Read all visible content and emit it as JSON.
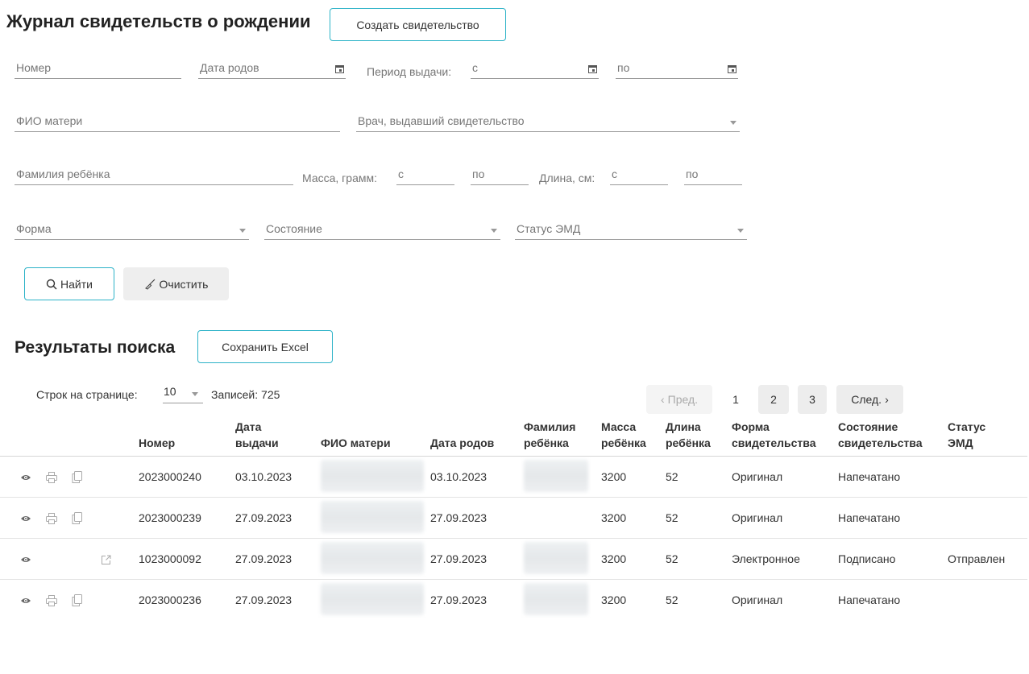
{
  "header": {
    "title": "Журнал свидетельств о рождении",
    "create_button": "Создать свидетельство"
  },
  "filters": {
    "number": "Номер",
    "birth_date": "Дата родов",
    "issue_period_label": "Период выдачи:",
    "from": "с",
    "to": "по",
    "mother_name": "ФИО матери",
    "doctor": "Врач, выдавший свидетельство",
    "child_surname": "Фамилия ребёнка",
    "mass_label": "Масса, грамм:",
    "length_label": "Длина, см:",
    "form": "Форма",
    "state": "Состояние",
    "emd_status": "Статус ЭМД",
    "search_button": "Найти",
    "clear_button": "Очистить"
  },
  "results": {
    "title": "Результаты поиска",
    "excel_button": "Сохранить Excel",
    "rows_per_page_label": "Строк на странице:",
    "rows_per_page_value": "10",
    "records_label": "Записей:",
    "records_value": "725"
  },
  "pagination": {
    "prev": "Пред.",
    "pages": [
      "1",
      "2",
      "3"
    ],
    "next": "След."
  },
  "table": {
    "headers": {
      "number": "Номер",
      "issue_date": "Дата выдачи",
      "mother": "ФИО матери",
      "birth_date": "Дата родов",
      "child_surname": "Фамилия ребёнка",
      "mass": "Масса ребёнка",
      "length": "Длина ребёнка",
      "form": "Форма свидетельства",
      "state": "Состояние свидетельства",
      "emd": "Статус ЭМД"
    },
    "rows": [
      {
        "number": "2023000240",
        "issue_date": "03.10.2023",
        "birth_date": "03.10.2023",
        "mass": "3200",
        "length": "52",
        "form": "Оригинал",
        "state": "Напечатано",
        "emd": ""
      },
      {
        "number": "2023000239",
        "issue_date": "27.09.2023",
        "birth_date": "27.09.2023",
        "mass": "3200",
        "length": "52",
        "form": "Оригинал",
        "state": "Напечатано",
        "emd": ""
      },
      {
        "number": "1023000092",
        "issue_date": "27.09.2023",
        "birth_date": "27.09.2023",
        "mass": "3200",
        "length": "52",
        "form": "Электронное",
        "state": "Подписано",
        "emd": "Отправлен"
      },
      {
        "number": "2023000236",
        "issue_date": "27.09.2023",
        "birth_date": "27.09.2023",
        "mass": "3200",
        "length": "52",
        "form": "Оригинал",
        "state": "Напечатано",
        "emd": ""
      }
    ]
  }
}
